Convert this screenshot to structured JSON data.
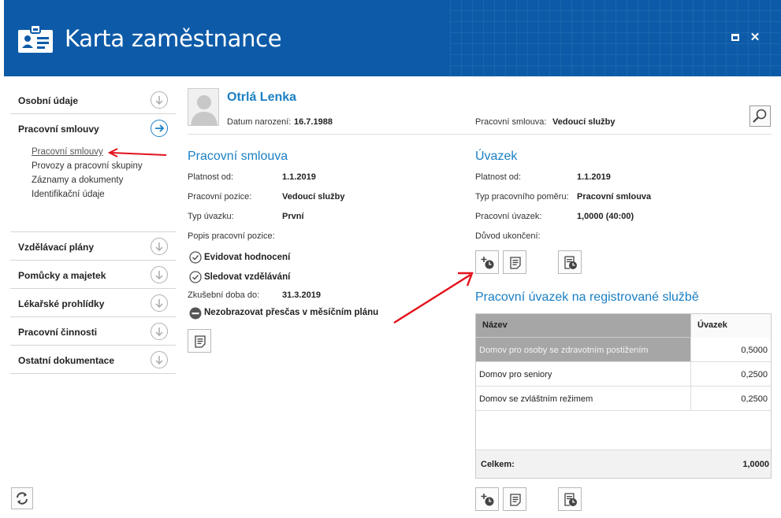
{
  "window": {
    "title": "Karta zaměstnance",
    "maximize_icon": "maximize-icon",
    "close_icon": "close-icon",
    "close_glyph": "✕"
  },
  "sidebar": {
    "sections": [
      {
        "label": "Osobní údaje",
        "icon": "arrow-down-circle-icon"
      },
      {
        "label": "Pracovní smlouvy",
        "icon": "arrow-right-circle-icon",
        "active": true
      },
      {
        "label": "Vzdělávací plány",
        "icon": "arrow-down-circle-icon"
      },
      {
        "label": "Pomůcky a majetek",
        "icon": "arrow-down-circle-icon"
      },
      {
        "label": "Lékařské prohlídky",
        "icon": "arrow-down-circle-icon"
      },
      {
        "label": "Pracovní činnosti",
        "icon": "arrow-down-circle-icon"
      },
      {
        "label": "Ostatní dokumentace",
        "icon": "arrow-down-circle-icon"
      }
    ],
    "subitems": [
      {
        "label": "Pracovní smlouvy",
        "active": true
      },
      {
        "label": "Provozy a pracovní skupiny"
      },
      {
        "label": "Záznamy a dokumenty"
      },
      {
        "label": "Identifikační údaje"
      }
    ]
  },
  "employee": {
    "name": "Otrlá Lenka",
    "birth_label": "Datum narození:",
    "birth_value": "16.7.1988",
    "contract_label": "Pracovní smlouva:",
    "contract_value": "Vedoucí služby"
  },
  "contract": {
    "title": "Pracovní smlouva",
    "fields": [
      {
        "label": "Platnost od:",
        "value": "1.1.2019"
      },
      {
        "label": "Pracovní pozice:",
        "value": "Vedoucí služby"
      },
      {
        "label": "Typ úvazku:",
        "value": "První"
      },
      {
        "label": "Popis pracovní pozice:",
        "value": ""
      }
    ],
    "checks": [
      {
        "label": "Evidovat hodnocení",
        "icon": "check-circle-icon"
      },
      {
        "label": "Sledovat vzdělávání",
        "icon": "check-circle-icon"
      }
    ],
    "probation_label": "Zkušební doba do:",
    "probation_value": "31.3.2019",
    "overtime_label": "Nezobrazovat přesčas v měsíčním plánu",
    "overtime_icon": "minus-circle-icon"
  },
  "workload": {
    "title": "Úvazek",
    "fields": [
      {
        "label": "Platnost od:",
        "value": "1.1.2019"
      },
      {
        "label": "Typ pracovního poměru:",
        "value": "Pracovní smlouva"
      },
      {
        "label": "Pracovní úvazek:",
        "value": "1,0000 (40:00)"
      },
      {
        "label": "Důvod ukončení:",
        "value": ""
      }
    ]
  },
  "services": {
    "title": "Pracovní úvazek na registrované službě",
    "columns": [
      "Název",
      "Úvazek"
    ],
    "rows": [
      {
        "name": "Domov pro osoby se zdravotním postižením",
        "value": "0,5000"
      },
      {
        "name": "Domov pro seniory",
        "value": "0,2500"
      },
      {
        "name": "Domov se zvláštním režimem",
        "value": "0,2500"
      }
    ],
    "total_label": "Celkem:",
    "total_value": "1,0000"
  },
  "colors": {
    "header": "#0d5ba8",
    "accent": "#1a7fc4",
    "annotation": "#e3111c"
  }
}
